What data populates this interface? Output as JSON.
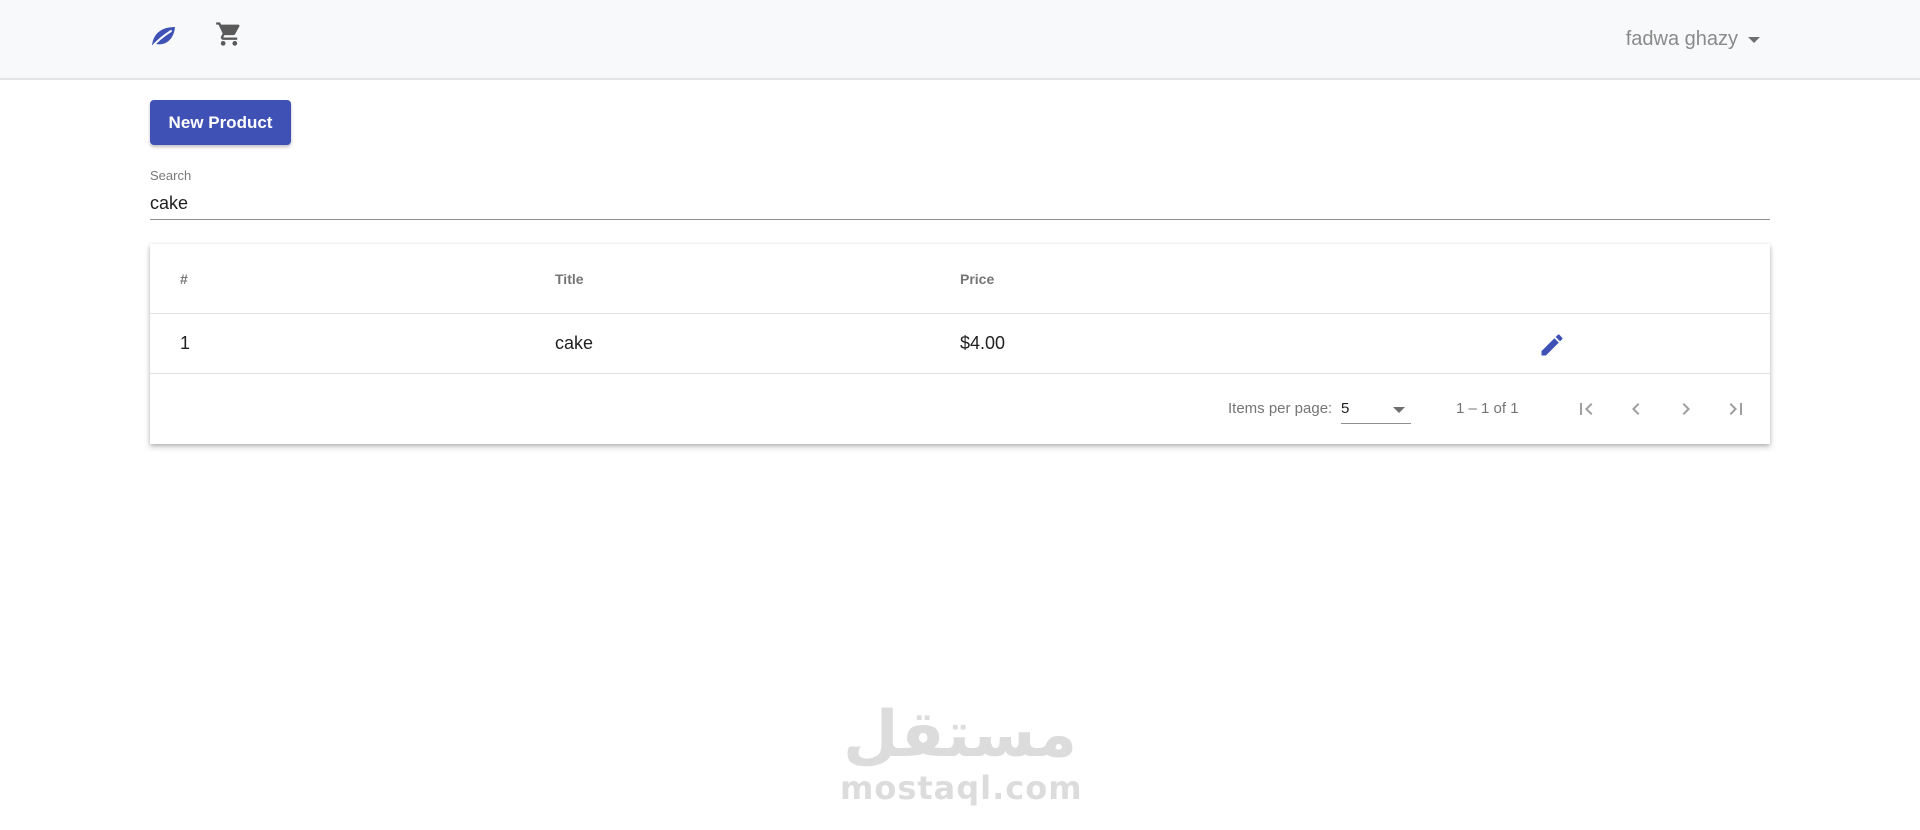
{
  "navbar": {
    "brand_icon": "leaf-icon",
    "cart_icon": "cart-icon",
    "user_name": "fadwa ghazy"
  },
  "toolbar": {
    "new_product_label": "New Product"
  },
  "search": {
    "label": "Search",
    "value": "cake"
  },
  "table": {
    "headers": {
      "num": "#",
      "title": "Title",
      "price": "Price"
    },
    "rows": [
      {
        "num": "1",
        "title": "cake",
        "price": "$4.00",
        "action_icon": "edit-icon"
      }
    ]
  },
  "paginator": {
    "items_per_page_label": "Items per page:",
    "items_per_page_value": "5",
    "range_label": "1 – 1 of 1",
    "icons": [
      "first-page-icon",
      "previous-page-icon",
      "next-page-icon",
      "last-page-icon"
    ]
  },
  "watermark": {
    "arabic": "مستقل",
    "latin": "mostaql.com"
  },
  "colors": {
    "primary": "#3f51b5",
    "navbar_bg": "#f8f9fa",
    "muted_text": "#757575"
  }
}
